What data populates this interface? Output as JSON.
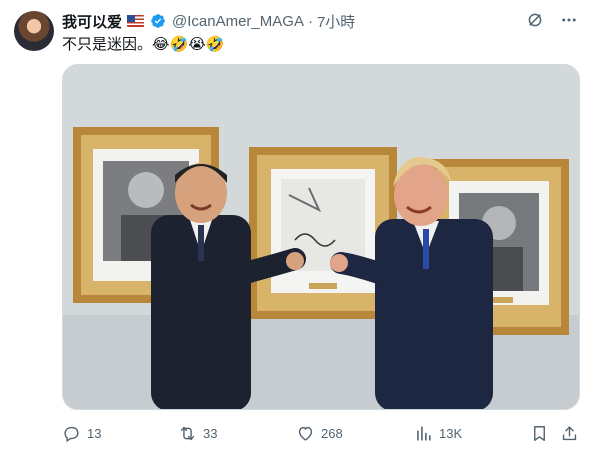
{
  "author": {
    "name": "我可以爱",
    "handle": "@IcanAmer_MAGA",
    "separator": "·",
    "time": "7小時"
  },
  "post": {
    "text": "不只是迷因。😂🤣😭🤣"
  },
  "actions": {
    "replies": "13",
    "reposts": "33",
    "likes": "268",
    "views": "13K"
  },
  "colors": {
    "text_secondary": "#536471",
    "verified_blue": "#1d9bf0",
    "frame_gold": "#b8873a"
  },
  "icons": [
    "grok-icon",
    "more-icon",
    "reply-icon",
    "repost-icon",
    "like-icon",
    "views-icon",
    "bookmark-icon",
    "share-icon"
  ]
}
